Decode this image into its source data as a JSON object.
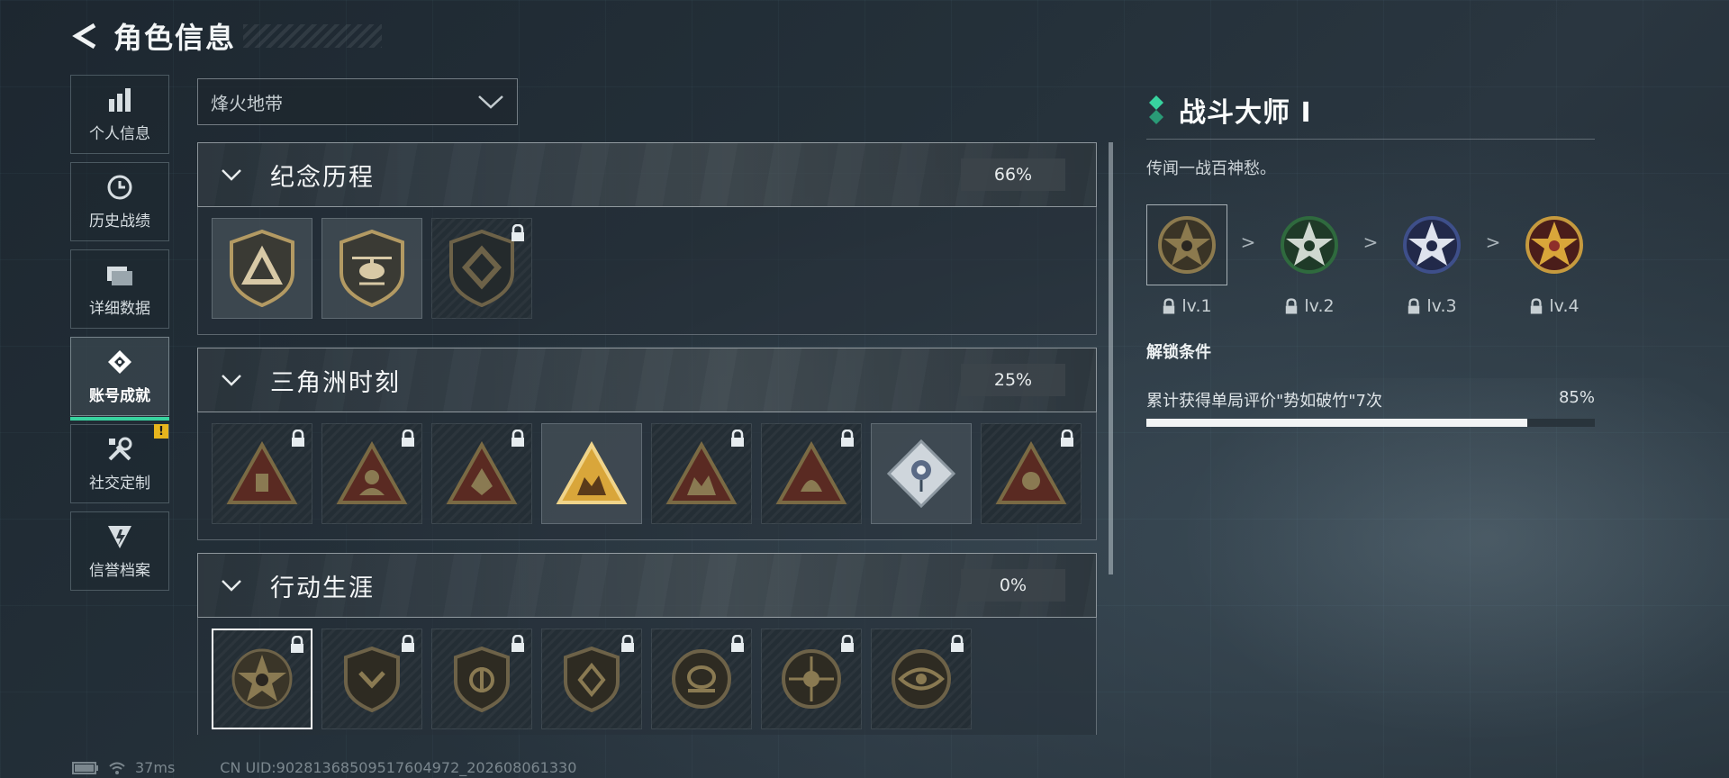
{
  "header": {
    "title": "角色信息"
  },
  "sidebar": {
    "items": [
      {
        "label": "个人信息",
        "icon": "bar-chart-icon"
      },
      {
        "label": "历史战绩",
        "icon": "clock-icon"
      },
      {
        "label": "详细数据",
        "icon": "folder-icon"
      },
      {
        "label": "账号成就",
        "icon": "achievement-icon",
        "active": true
      },
      {
        "label": "社交定制",
        "icon": "wrench-icon",
        "badge": "!"
      },
      {
        "label": "信誉档案",
        "icon": "reputation-icon"
      }
    ]
  },
  "mode_dropdown": {
    "value": "烽火地带"
  },
  "categories": [
    {
      "title": "纪念历程",
      "percent": "66%",
      "badges": [
        {
          "icon": "triangle-shield-badge",
          "locked": false
        },
        {
          "icon": "helicopter-shield-badge",
          "locked": false
        },
        {
          "icon": "diamond-shield-badge",
          "locked": true
        }
      ]
    },
    {
      "title": "三角洲时刻",
      "percent": "25%",
      "badges": [
        {
          "icon": "triangle-badge-1",
          "locked": true
        },
        {
          "icon": "triangle-badge-2",
          "locked": true
        },
        {
          "icon": "triangle-badge-3",
          "locked": true
        },
        {
          "icon": "triangle-badge-4",
          "locked": false
        },
        {
          "icon": "triangle-badge-5",
          "locked": true
        },
        {
          "icon": "triangle-badge-6",
          "locked": true
        },
        {
          "icon": "rose-diamond-badge",
          "locked": false
        },
        {
          "icon": "triangle-badge-7",
          "locked": true
        }
      ]
    },
    {
      "title": "行动生涯",
      "percent": "0%",
      "badges": [
        {
          "icon": "star-skull-badge",
          "locked": true,
          "selected": true
        },
        {
          "icon": "shield-badge-1",
          "locked": true
        },
        {
          "icon": "shield-badge-2",
          "locked": true
        },
        {
          "icon": "shield-badge-3",
          "locked": true
        },
        {
          "icon": "round-badge-1",
          "locked": true
        },
        {
          "icon": "round-badge-2",
          "locked": true
        },
        {
          "icon": "round-badge-3",
          "locked": true
        }
      ]
    }
  ],
  "detail": {
    "title": "战斗大师 Ⅰ",
    "description": "传闻一战百神愁。",
    "levels": [
      {
        "label": "lv.1",
        "color": "#8c7a4e",
        "locked": true
      },
      {
        "label": "lv.2",
        "color": "#2f6a3e",
        "locked": true
      },
      {
        "label": "lv.3",
        "color": "#3e4f8a",
        "locked": true
      },
      {
        "label": "lv.4",
        "color": "#8e2f2a",
        "locked": true
      }
    ],
    "level_separator": ">",
    "condition_title": "解锁条件",
    "condition_text": "累计获得单局评价\"势如破竹\"7次",
    "condition_percent": "85%",
    "progress": 0.85
  },
  "footer": {
    "ping": "37ms",
    "uid": "CN UID:90281368509517604972_202608061330"
  },
  "colors": {
    "accent": "#38d39f",
    "warning": "#e7b51d",
    "gold": "#b39a63"
  }
}
